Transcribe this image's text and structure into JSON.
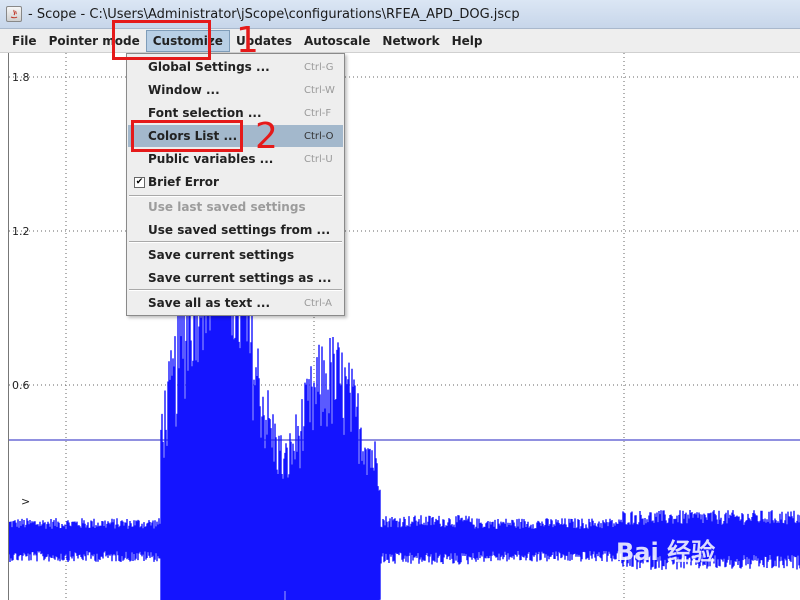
{
  "window": {
    "title": "- Scope - C:\\Users\\Administrator\\jScope\\configurations\\RFEA_APD_DOG.jscp"
  },
  "menubar": [
    {
      "label": "File"
    },
    {
      "label": "Pointer mode"
    },
    {
      "label": "Customize"
    },
    {
      "label": "Updates"
    },
    {
      "label": "Autoscale"
    },
    {
      "label": "Network"
    },
    {
      "label": "Help"
    }
  ],
  "customize_menu": {
    "items": [
      {
        "label": "Global Settings ...",
        "shortcut": "Ctrl-G"
      },
      {
        "label": "Window ...",
        "shortcut": "Ctrl-W"
      },
      {
        "label": "Font selection ...",
        "shortcut": "Ctrl-F"
      },
      {
        "label": "Colors List ...",
        "shortcut": "Ctrl-O"
      },
      {
        "label": "Public variables ...",
        "shortcut": "Ctrl-U"
      },
      {
        "label": "Brief Error",
        "shortcut": ""
      },
      {
        "label": "Use last saved settings",
        "shortcut": ""
      },
      {
        "label": "Use saved settings from ...",
        "shortcut": ""
      },
      {
        "label": "Save current settings",
        "shortcut": ""
      },
      {
        "label": "Save current settings as ...",
        "shortcut": ""
      },
      {
        "label": "Save all as text ...",
        "shortcut": "Ctrl-A"
      }
    ],
    "highlighted": "Colors List ...",
    "brief_error_checked": true
  },
  "plot": {
    "y_ticks": [
      "1.8",
      "1.2",
      "0.6"
    ],
    "marker_text": ">",
    "trace_color": "#1414ff"
  },
  "annotations": {
    "step1": "1",
    "step2": "2"
  },
  "watermark": "Bai 经验"
}
